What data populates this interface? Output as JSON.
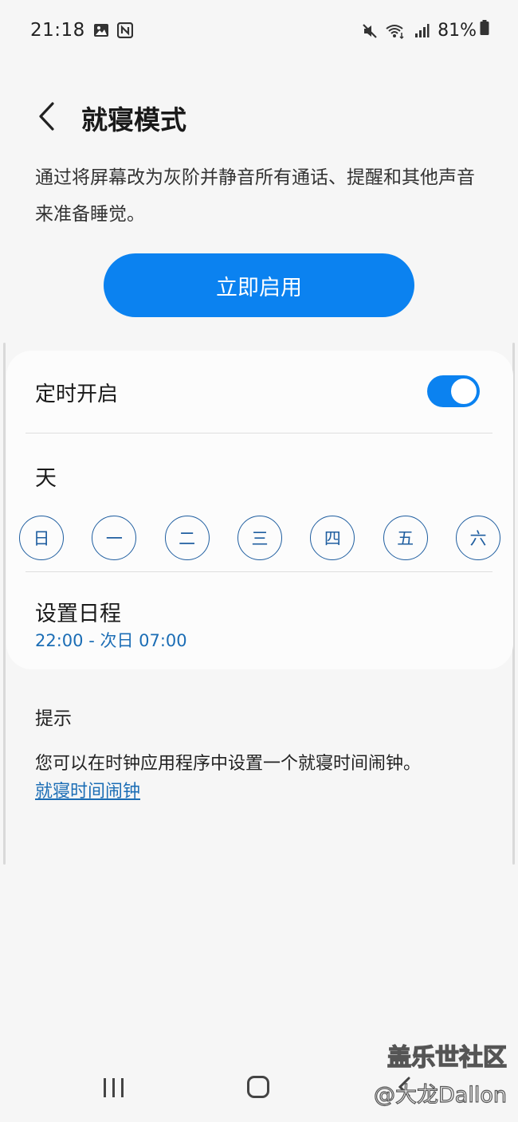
{
  "status_bar": {
    "time": "21:18",
    "battery_level": "81%",
    "left_icons": [
      "gallery-notification-icon",
      "nfc-notification-icon"
    ],
    "right_icons": [
      "mute-icon",
      "wifi-icon",
      "signal-icon",
      "battery-icon"
    ]
  },
  "header": {
    "title": "就寝模式",
    "back_icon": "chevron-left-icon"
  },
  "description": "通过将屏幕改为灰阶并静音所有通话、提醒和其他声音来准备睡觉。",
  "start_button": {
    "label": "立即启用",
    "color": "#0b82f0"
  },
  "schedule_card": {
    "scheduled_label": "定时开启",
    "scheduled_toggle_on": true,
    "days_label": "天",
    "days": [
      "日",
      "一",
      "二",
      "三",
      "四",
      "五",
      "六"
    ],
    "set_schedule_label": "设置日程",
    "schedule_value": "22:00 - 次日 07:00"
  },
  "tips": {
    "title": "提示",
    "text": "您可以在时钟应用程序中设置一个就寝时间闹钟。",
    "link": "就寝时间闹钟"
  },
  "nav_bar": {
    "icons": [
      "recent-apps-icon",
      "home-icon",
      "back-icon"
    ]
  },
  "watermark": {
    "brand": "盖乐世社区",
    "user": "@大龙Dallon"
  }
}
